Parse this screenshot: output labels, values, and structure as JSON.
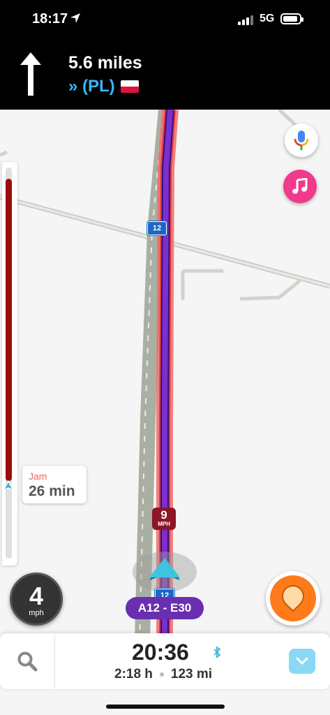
{
  "status_bar": {
    "time": "18:17",
    "network": "5G"
  },
  "navigation": {
    "distance": "5.6 miles",
    "street": "» (PL)"
  },
  "map": {
    "road_shield_top": "12",
    "road_shield_bottom": "12",
    "speed_limit": {
      "value": "9",
      "unit": "MPH"
    },
    "road_label": "A12 - E30"
  },
  "traffic": {
    "label": "Jam",
    "delay": "26 min"
  },
  "speedometer": {
    "value": "4",
    "unit": "mph"
  },
  "trip": {
    "eta": "20:36",
    "duration": "2:18 h",
    "distance": "123 mi"
  },
  "colors": {
    "route": "#6a2fb0",
    "jam": "#9b0d0d",
    "accent": "#39b6ff",
    "report": "#ff7a1a",
    "music": "#f03a8c"
  }
}
